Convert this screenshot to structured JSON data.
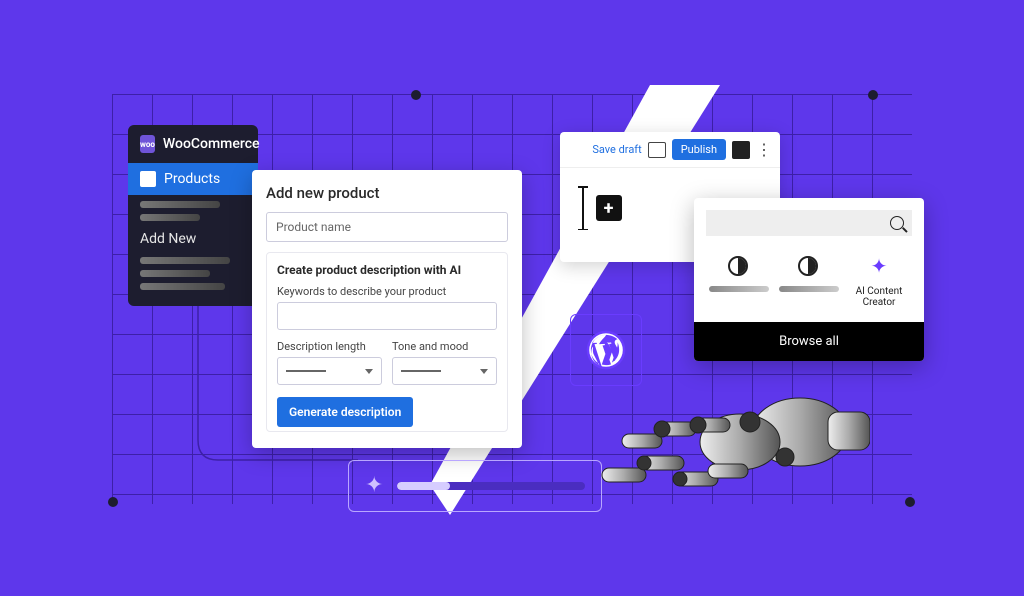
{
  "sidebar": {
    "title": "WooCommerce",
    "active_item": "Products",
    "add_new": "Add New"
  },
  "product_panel": {
    "title": "Add new product",
    "name_placeholder": "Product name",
    "ai_heading": "Create product description with AI",
    "keywords_label": "Keywords to describe your product",
    "length_label": "Description length",
    "tone_label": "Tone and mood",
    "generate_btn": "Generate description"
  },
  "editor": {
    "save_draft": "Save draft",
    "publish": "Publish"
  },
  "picker": {
    "ai_label": "AI Content Creator",
    "browse": "Browse all"
  }
}
